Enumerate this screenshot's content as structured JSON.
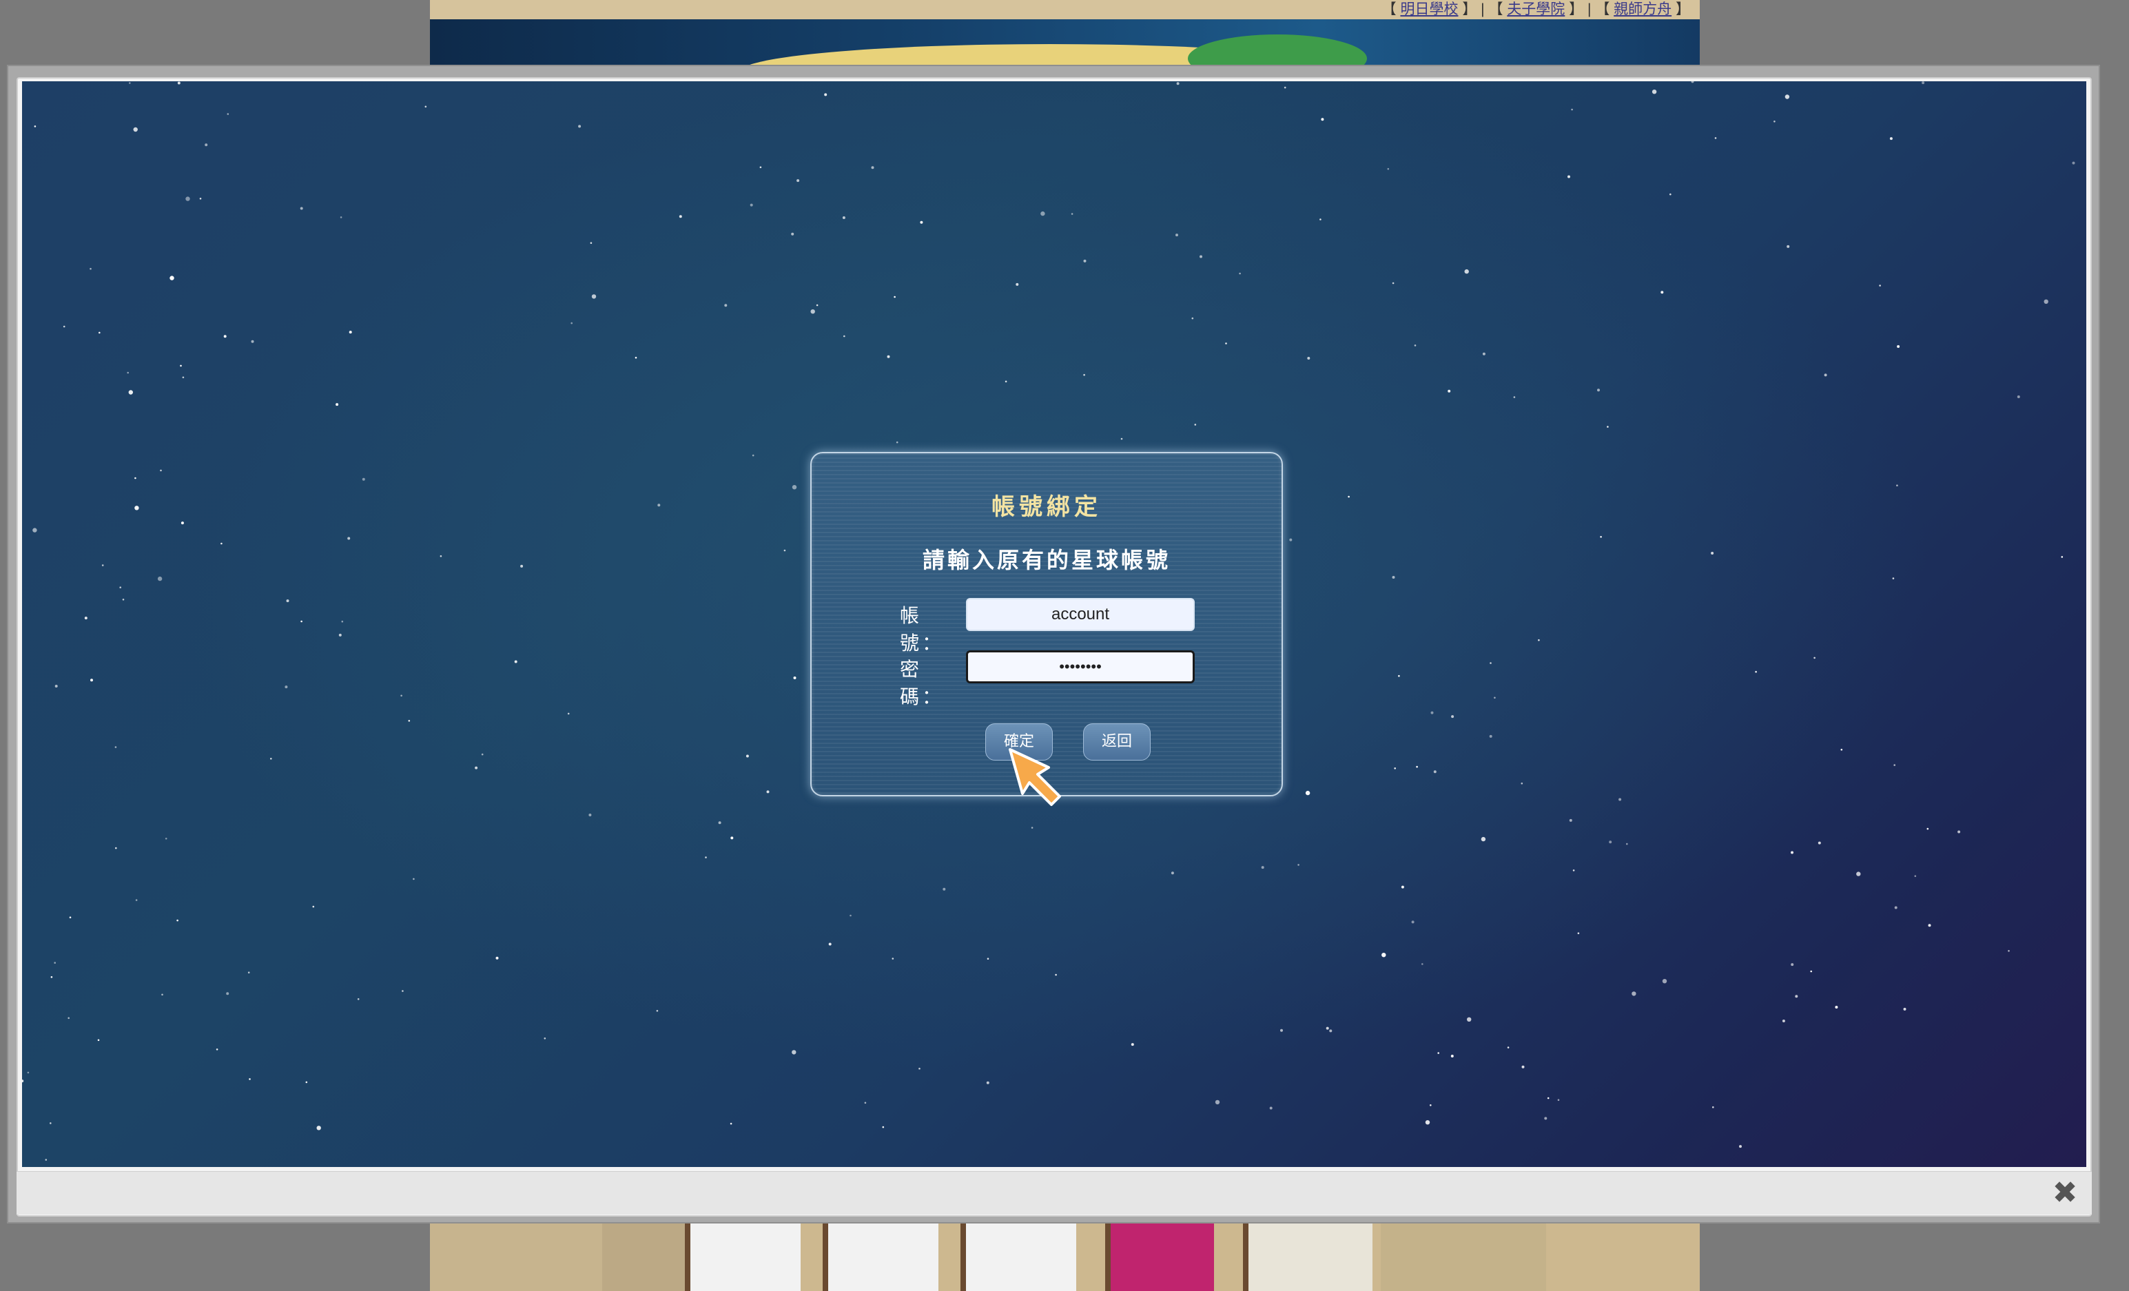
{
  "top_links": {
    "items": [
      "明日學校",
      "夫子學院",
      "親師方舟"
    ],
    "open_bracket": "【",
    "close_bracket": "】",
    "separator": "|"
  },
  "dialog": {
    "title": "帳號綁定",
    "subtitle": "請輸入原有的星球帳號",
    "account_label": "帳號：",
    "account_value": "account",
    "password_label": "密碼：",
    "password_value": "••••••••",
    "confirm_label": "確定",
    "back_label": "返回"
  },
  "modal": {
    "close_icon": "close-icon"
  },
  "colors": {
    "title_gold": "#f3e3a2",
    "space_bg": "#1d4466",
    "cursor_orange": "#f7a94a"
  }
}
